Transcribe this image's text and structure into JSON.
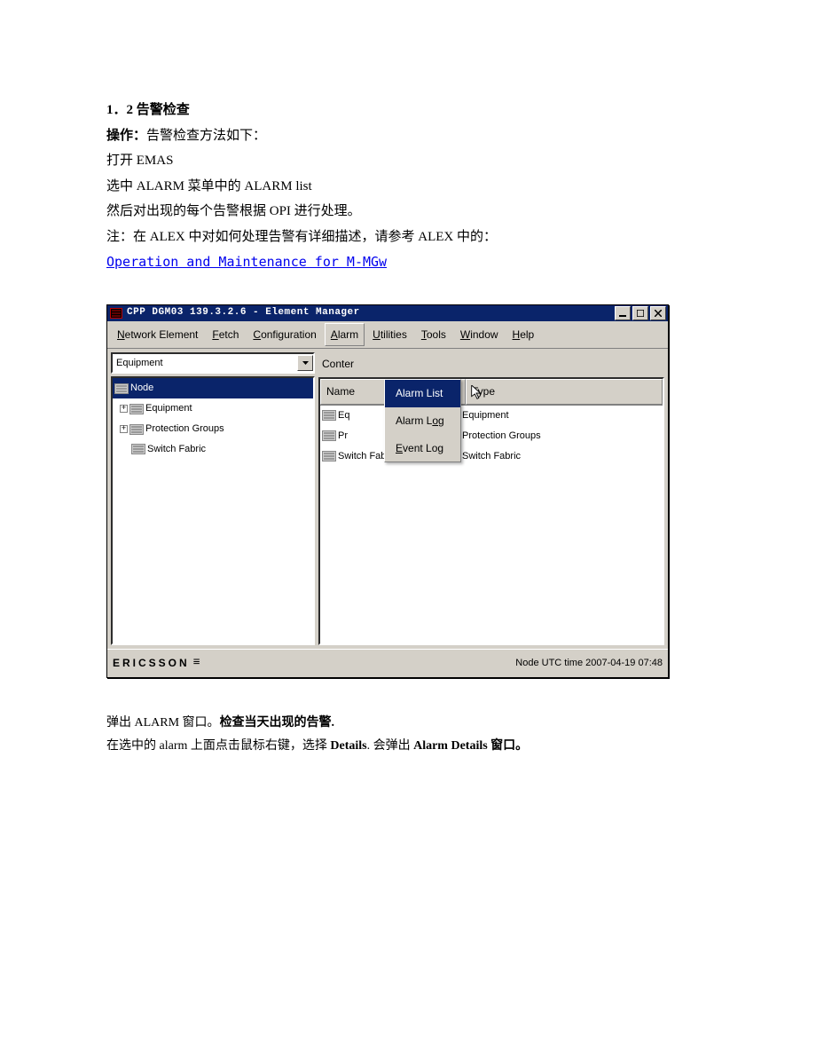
{
  "doc": {
    "heading": "1．2 告警检查",
    "op_label": "操作：",
    "op_text": "告警检查方法如下：",
    "line1": "打开 EMAS",
    "line2": "选中 ALARM 菜单中的 ALARM list",
    "line3": "然后对出现的每个告警根据 OPI 进行处理。",
    "line4": "注：在 ALEX 中对如何处理告警有详细描述，请参考 ALEX 中的：",
    "link": "Operation and Maintenance for M-MGw",
    "after1_a": "弹出 ALARM 窗口。",
    "after1_b": "检查当天出现的告警.",
    "after2_a": "在选中的 alarm 上面点击鼠标右键，选择 ",
    "after2_b": "Details",
    "after2_c": ".  会弹出  ",
    "after2_d": "Alarm Details 窗口。"
  },
  "app": {
    "title": "CPP DGM03 139.3.2.6 - Element Manager",
    "menus": {
      "network_element": "Network Element",
      "fetch": "Fetch",
      "configuration": "Configuration",
      "alarm": "Alarm",
      "utilities": "Utilities",
      "tools": "Tools",
      "window": "Window",
      "help": "Help"
    },
    "dropdown": {
      "alarm_list": "Alarm List",
      "alarm_log": "Alarm Log",
      "event_log": "Event Log"
    },
    "combo": "Equipment",
    "tree": {
      "node": "Node",
      "equipment": "Equipment",
      "protection_groups": "Protection Groups",
      "switch_fabric": "Switch Fabric"
    },
    "conter_label": "Conter",
    "list_header": {
      "name": "Name",
      "type": "Type"
    },
    "list": [
      {
        "name": "Eq",
        "type": "Equipment"
      },
      {
        "name": "Pr",
        "type": "Protection Groups"
      },
      {
        "name": "Switch Fabric",
        "type": "Switch Fabric"
      }
    ],
    "status": {
      "brand": "ERICSSON",
      "utc": "Node UTC time 2007-04-19 07:48"
    }
  }
}
